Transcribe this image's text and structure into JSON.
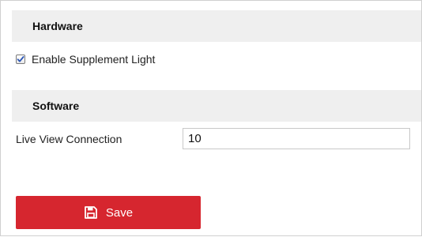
{
  "hardware": {
    "title": "Hardware",
    "supplement_light": {
      "label": "Enable Supplement Light",
      "checked": true
    }
  },
  "software": {
    "title": "Software",
    "live_view_connection": {
      "label": "Live View Connection",
      "value": "10"
    }
  },
  "actions": {
    "save_label": "Save",
    "save_icon": "floppy-disk-icon"
  },
  "colors": {
    "accent": "#d6262f",
    "section_background": "#efefef",
    "checkbox_check": "#2a55b5"
  }
}
